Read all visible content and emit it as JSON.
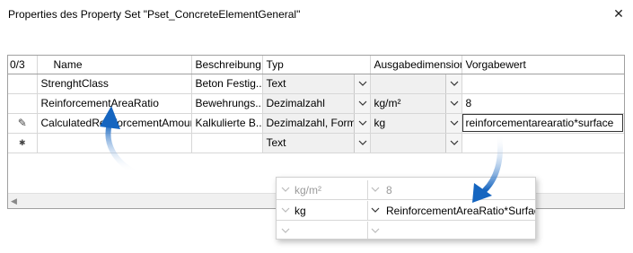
{
  "window": {
    "title": "Properties des Property Set \"Pset_ConcreteElementGeneral\"",
    "close_glyph": "✕"
  },
  "grid": {
    "row_count": "0/3",
    "columns": [
      "Name",
      "Beschreibung",
      "Typ",
      "Ausgabedimension",
      "Vorgabewert"
    ],
    "rows": [
      {
        "marker": "",
        "name": "StrenghtClass",
        "desc": "Beton Festig...",
        "typ": "Text",
        "dim": "",
        "default": ""
      },
      {
        "marker": "",
        "name": "ReinforcementAreaRatio",
        "desc": "Bewehrungs...",
        "typ": "Dezimalzahl",
        "dim": "kg/m²",
        "default": "8"
      },
      {
        "marker": "✎",
        "name": "CalculatedReinforcementAmount",
        "desc": "Kalkulierte B...",
        "typ": "Dezimalzahl, Formel",
        "dim": "kg",
        "default": "reinforcementarearatio*surface"
      },
      {
        "marker": "✱",
        "name": "",
        "desc": "",
        "typ": "Text",
        "dim": "",
        "default": ""
      }
    ]
  },
  "zoom": {
    "rows": [
      {
        "dim": "kg/m²",
        "value": "8",
        "dimmed": true
      },
      {
        "dim": "kg",
        "value": "ReinforcementAreaRatio*Surface",
        "dimmed": false
      },
      {
        "dim": "",
        "value": "",
        "dimmed": true
      }
    ]
  },
  "colors": {
    "arrow": "#1565c0",
    "combo_bg": "#f0f0f0",
    "border": "#a0a0a0"
  },
  "icons": {
    "close": "close-icon",
    "dropdown": "chevron-down-icon",
    "edit": "pencil-icon",
    "new_row": "asterisk-icon"
  }
}
